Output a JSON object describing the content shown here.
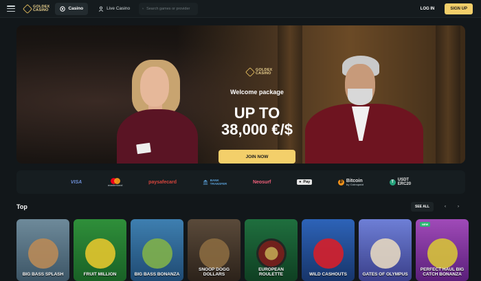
{
  "header": {
    "logo_top": "GOLDEX",
    "logo_bottom": "CASINO",
    "tabs": [
      {
        "label": "Casino",
        "active": true
      },
      {
        "label": "Live Casino",
        "active": false
      }
    ],
    "search_placeholder": "Search games or provider",
    "login_label": "LOG IN",
    "signup_label": "SIGN UP"
  },
  "hero": {
    "logo_top": "GOLDEX",
    "logo_bottom": "CASINO",
    "welcome": "Welcome package",
    "line1": "UP TO",
    "line2": "38,000 €/$",
    "cta": "JOIN NOW"
  },
  "payments": {
    "visa": "VISA",
    "mastercard": "mastercard",
    "paysafecard": "paysafecard",
    "bank_line1": "BANK",
    "bank_line2": "TRANSFER",
    "neosurf": "Neosurf",
    "applepay": "Pay",
    "bitcoin": "Bitcoin",
    "bitcoin_sub": "by Coinspaid",
    "usdt_line1": "USDT",
    "usdt_line2": "ERC20"
  },
  "top_section": {
    "title": "Top",
    "see_all": "SEE ALL",
    "prev": "‹",
    "next": "›"
  },
  "games": [
    {
      "name": "BIG BASS SPLASH"
    },
    {
      "name": "FRUIT MILLION"
    },
    {
      "name": "BIG BASS BONANZA"
    },
    {
      "name": "SNOOP DOGG DOLLARS"
    },
    {
      "name": "EUROPEAN ROULETTE"
    },
    {
      "name": "WILD CASHOUTS"
    },
    {
      "name": "GATES OF OLYMPUS"
    },
    {
      "name": "PERFECT HAUL BIG CATCH BONANZA",
      "badge": "NEW"
    }
  ],
  "colors": {
    "accent": "#f3cf6a",
    "background": "#12171a"
  }
}
